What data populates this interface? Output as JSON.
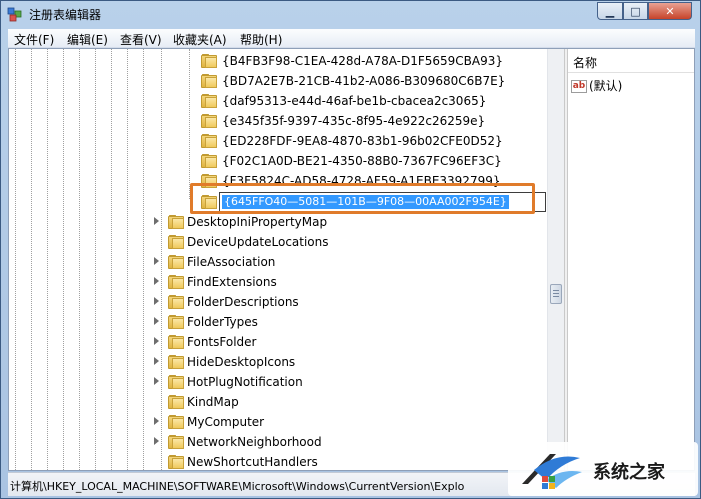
{
  "window": {
    "title": "注册表编辑器",
    "minimize_glyph": "▁",
    "maximize_glyph": "□",
    "close_glyph": "✕"
  },
  "menu": {
    "file": "文件(F)",
    "edit": "编辑(E)",
    "view": "查看(V)",
    "favorites": "收藏夹(A)",
    "help": "帮助(H)"
  },
  "tree": {
    "guid_items": [
      "{B4FB3F98-C1EA-428d-A78A-D1F5659CBA93}",
      "{BD7A2E7B-21CB-41b2-A086-B309680C6B7E}",
      "{daf95313-e44d-46af-be1b-cbacea2c3065}",
      "{e345f35f-9397-435c-8f95-4e922c26259e}",
      "{ED228FDF-9EA8-4870-83b1-96b02CFE0D52}",
      "{F02C1A0D-BE21-4350-88B0-7367FC96EF3C}",
      "{F3F5824C-AD58-4728-AF59-A1EBE3392799}"
    ],
    "editing_value": "{645FFO40—5081—101B—9F08—00AA002F954E}",
    "key_items": [
      "DesktopIniPropertyMap",
      "DeviceUpdateLocations",
      "FileAssociation",
      "FindExtensions",
      "FolderDescriptions",
      "FolderTypes",
      "FontsFolder",
      "HideDesktopIcons",
      "HotPlugNotification",
      "KindMap",
      "MyComputer",
      "NetworkNeighborhood",
      "NewShortcutHandlers"
    ]
  },
  "values_pane": {
    "column_name": "名称",
    "default_value_icon": "ab",
    "default_value": "(默认)"
  },
  "statusbar": {
    "path": "计算机\\HKEY_LOCAL_MACHINE\\SOFTWARE\\Microsoft\\Windows\\CurrentVersion\\Explo"
  },
  "watermark": {
    "text": "系统之家"
  },
  "colors": {
    "selection": "#3399ff",
    "highlight_frame": "#e07b2a",
    "title_gradient": "#b9d1ea"
  }
}
